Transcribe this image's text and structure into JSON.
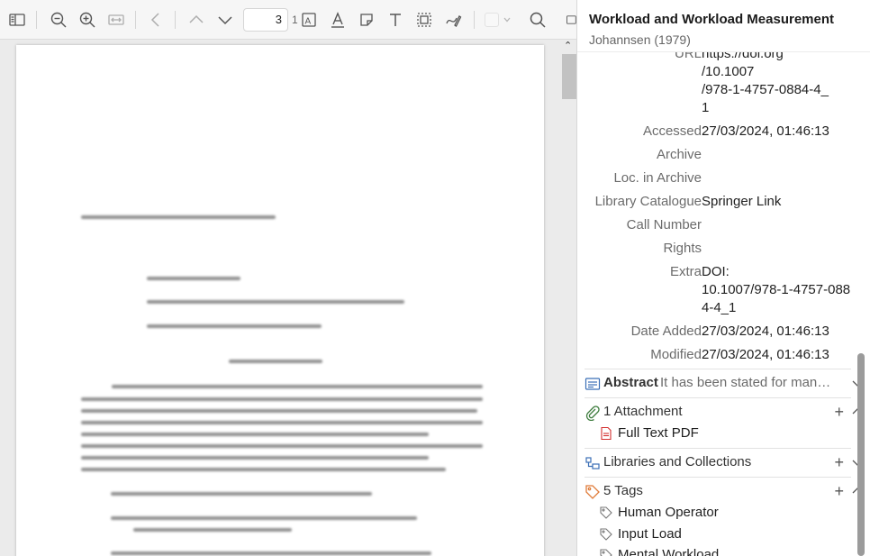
{
  "toolbar": {
    "page_number": "3",
    "page_total": "1"
  },
  "item": {
    "title": "Workload and Workload Measurement",
    "subtitle": "Johannsen (1979)",
    "fields": [
      {
        "label": "URL",
        "value_lines": [
          "https://doi.org",
          "/10.1007",
          "/978-1-4757-0884-4_",
          "1"
        ]
      },
      {
        "label": "Accessed",
        "value_lines": [
          "27/03/2024, 01:46:13"
        ]
      },
      {
        "label": "Archive",
        "value_lines": [
          ""
        ]
      },
      {
        "label": "Loc. in Archive",
        "value_lines": [
          ""
        ]
      },
      {
        "label": "Library Catalogue",
        "value_lines": [
          "Springer Link"
        ]
      },
      {
        "label": "Call Number",
        "value_lines": [
          ""
        ]
      },
      {
        "label": "Rights",
        "value_lines": [
          ""
        ]
      },
      {
        "label": "Extra",
        "value_lines": [
          "DOI:",
          "10.1007/978-1-4757-088",
          "4-4_1"
        ]
      },
      {
        "label": "Date Added",
        "value_lines": [
          "27/03/2024, 01:46:13"
        ]
      },
      {
        "label": "Modified",
        "value_lines": [
          "27/03/2024, 01:46:13"
        ]
      }
    ]
  },
  "sections": {
    "abstract": {
      "title": "Abstract",
      "preview": "It has been stated for many…"
    },
    "attachments": {
      "title": "1 Attachment",
      "items": [
        "Full Text PDF"
      ]
    },
    "libraries": {
      "title": "Libraries and Collections"
    },
    "tags": {
      "title": "5 Tags",
      "items": [
        "Human Operator",
        "Input Load",
        "Mental Workload"
      ]
    }
  },
  "colors": {
    "accent": "#3d7c3d",
    "tag": "#e07b39",
    "pdf": "#d32f2f",
    "abstract_icon": "#3b6fb6"
  }
}
